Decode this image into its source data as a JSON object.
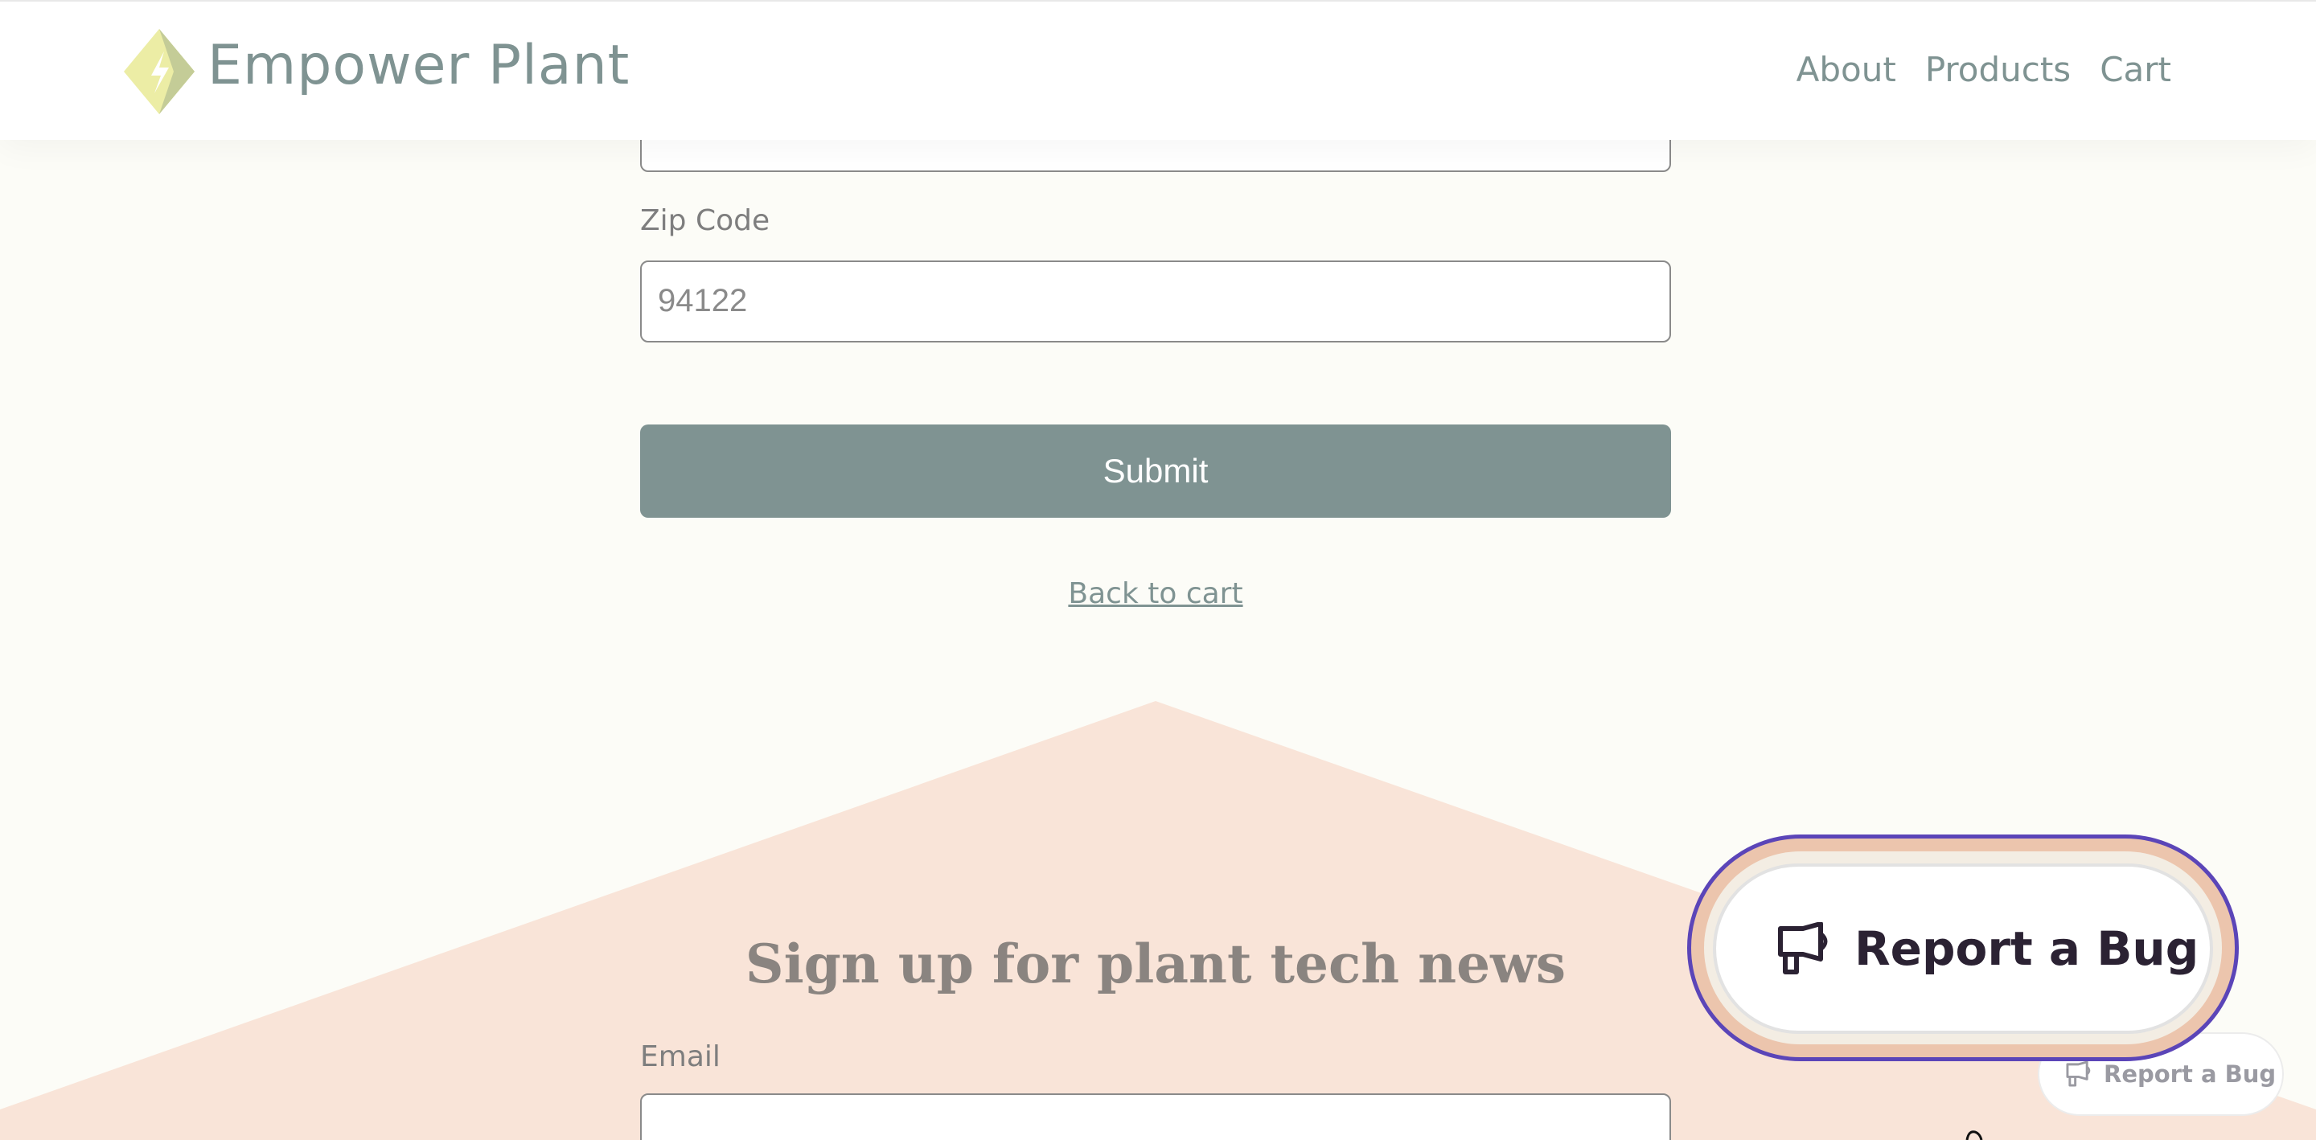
{
  "header": {
    "brand": "Empower Plant",
    "nav": [
      {
        "label": "About"
      },
      {
        "label": "Products"
      },
      {
        "label": "Cart"
      }
    ]
  },
  "form": {
    "zip_label": "Zip Code",
    "zip_value": "94122",
    "submit_label": "Submit",
    "back_link": "Back to cart"
  },
  "newsletter": {
    "title": "Sign up for plant tech news",
    "email_label": "Email"
  },
  "bug_widget": {
    "primary_label": "Report a Bug",
    "secondary_label": "Report a Bug"
  },
  "colors": {
    "accent": "#7f9392",
    "background": "#fcfcf7",
    "triangle": "#f9e4d8",
    "focus_ring": "#5b45b8"
  }
}
